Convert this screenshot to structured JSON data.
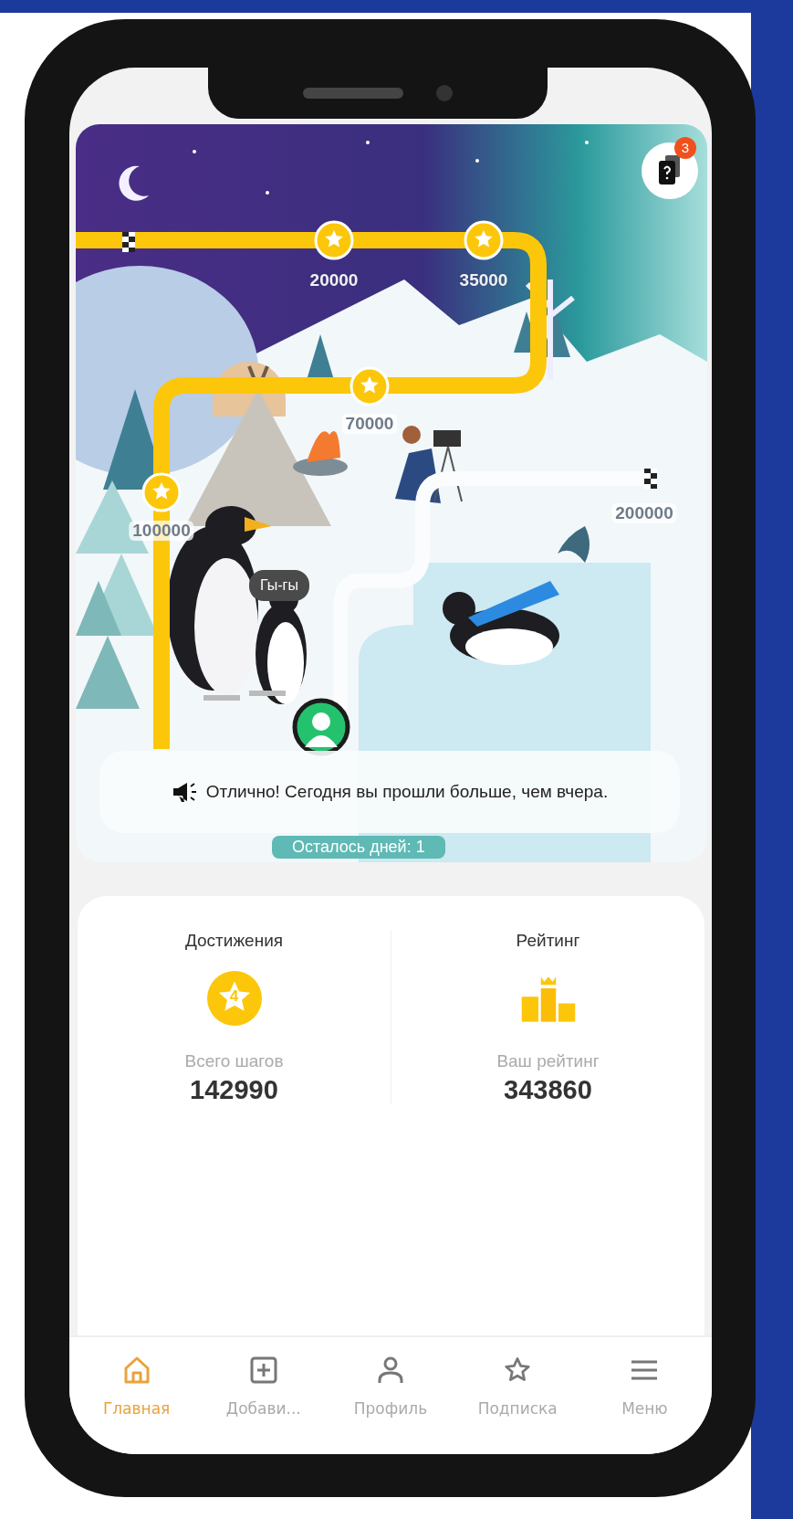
{
  "map": {
    "badge": "3",
    "milestones": [
      {
        "label": "20000",
        "kind": "star"
      },
      {
        "label": "35000",
        "kind": "star"
      },
      {
        "label": "70000",
        "kind": "star"
      },
      {
        "label": "100000",
        "kind": "star"
      },
      {
        "label": "200000",
        "kind": "flag"
      }
    ],
    "speech_bubble": "Гы-гы",
    "message": "Отлично! Сегодня вы прошли больше, чем вчера.",
    "days_left": "Осталось дней: 1"
  },
  "stats": [
    {
      "kind": "achievements",
      "title": "Достижения",
      "icon_text": "4",
      "caption": "Всего шагов",
      "value": "142990"
    },
    {
      "kind": "rating",
      "title": "Рейтинг",
      "caption": "Ваш рейтинг",
      "value": "343860"
    }
  ],
  "nav": [
    {
      "kind": "home",
      "label": "Главная",
      "selected": true
    },
    {
      "kind": "add",
      "label": "Добави...",
      "selected": false
    },
    {
      "kind": "profile",
      "label": "Профиль",
      "selected": false
    },
    {
      "kind": "subscription",
      "label": "Подписка",
      "selected": false
    },
    {
      "kind": "menu",
      "label": "Меню",
      "selected": false
    }
  ]
}
